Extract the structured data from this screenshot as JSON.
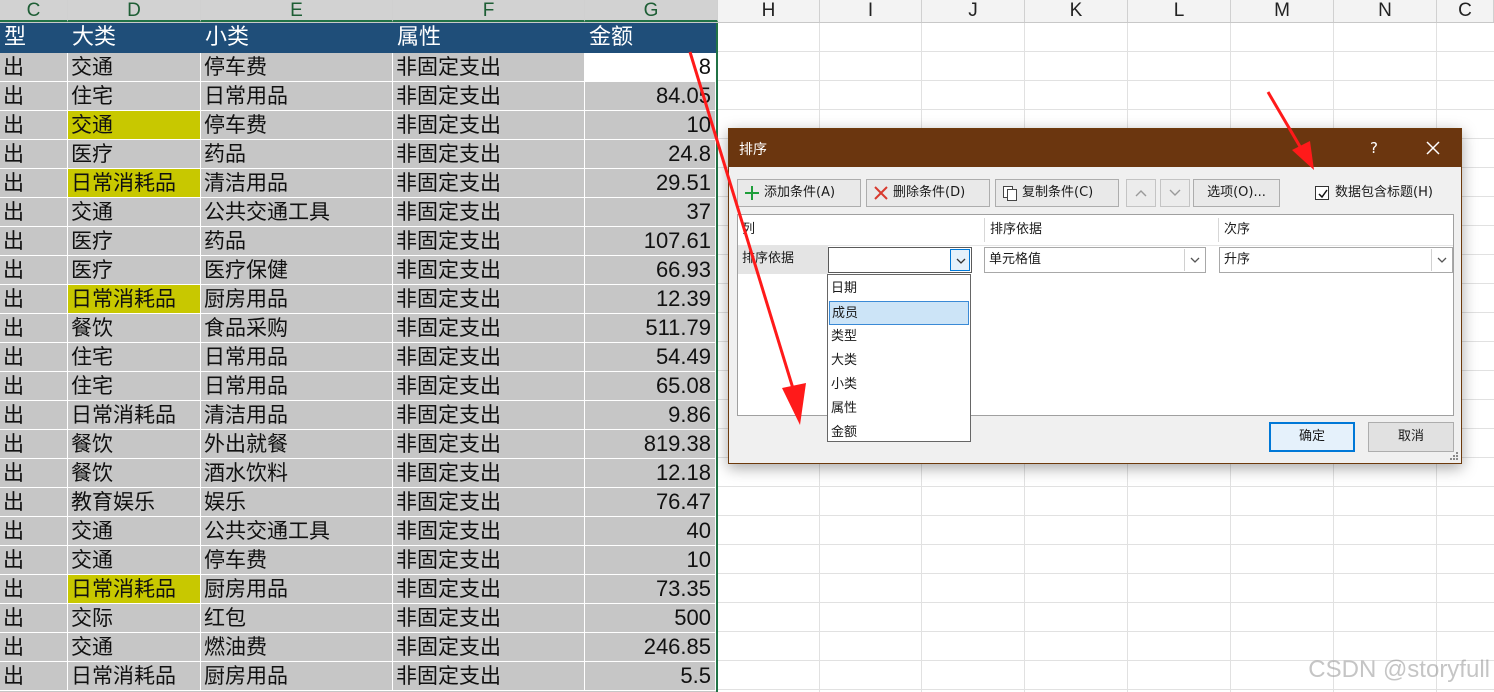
{
  "sheet": {
    "column_headers": [
      "C",
      "D",
      "E",
      "F",
      "G",
      "H",
      "I",
      "J",
      "K",
      "L",
      "M",
      "N",
      "C"
    ],
    "header_row": [
      "型",
      "大类",
      "小类",
      "属性",
      "金额"
    ],
    "rows": [
      [
        "出",
        "交通",
        "停车费",
        "非固定支出",
        "8"
      ],
      [
        "出",
        "住宅",
        "日常用品",
        "非固定支出",
        "84.05"
      ],
      [
        "出",
        "交通",
        "停车费",
        "非固定支出",
        "10"
      ],
      [
        "出",
        "医疗",
        "药品",
        "非固定支出",
        "24.8"
      ],
      [
        "出",
        "日常消耗品",
        "清洁用品",
        "非固定支出",
        "29.51"
      ],
      [
        "出",
        "交通",
        "公共交通工具",
        "非固定支出",
        "37"
      ],
      [
        "出",
        "医疗",
        "药品",
        "非固定支出",
        "107.61"
      ],
      [
        "出",
        "医疗",
        "医疗保健",
        "非固定支出",
        "66.93"
      ],
      [
        "出",
        "日常消耗品",
        "厨房用品",
        "非固定支出",
        "12.39"
      ],
      [
        "出",
        "餐饮",
        "食品采购",
        "非固定支出",
        "511.79"
      ],
      [
        "出",
        "住宅",
        "日常用品",
        "非固定支出",
        "54.49"
      ],
      [
        "出",
        "住宅",
        "日常用品",
        "非固定支出",
        "65.08"
      ],
      [
        "出",
        "日常消耗品",
        "清洁用品",
        "非固定支出",
        "9.86"
      ],
      [
        "出",
        "餐饮",
        "外出就餐",
        "非固定支出",
        "819.38"
      ],
      [
        "出",
        "餐饮",
        "酒水饮料",
        "非固定支出",
        "12.18"
      ],
      [
        "出",
        "教育娱乐",
        "娱乐",
        "非固定支出",
        "76.47"
      ],
      [
        "出",
        "交通",
        "公共交通工具",
        "非固定支出",
        "40"
      ],
      [
        "出",
        "交通",
        "停车费",
        "非固定支出",
        "10"
      ],
      [
        "出",
        "日常消耗品",
        "厨房用品",
        "非固定支出",
        "73.35"
      ],
      [
        "出",
        "交际",
        "红包",
        "非固定支出",
        "500"
      ],
      [
        "出",
        "交通",
        "燃油费",
        "非固定支出",
        "246.85"
      ],
      [
        "出",
        "日常消耗品",
        "厨房用品",
        "非固定支出",
        "5.5"
      ]
    ],
    "highlighted_rows": [
      2,
      4,
      8,
      18
    ],
    "colors": {
      "header_bg": "#1f4e79",
      "selection_bg": "#c6c6c6",
      "highlight": "#c8c800"
    }
  },
  "dialog": {
    "title": "排序",
    "help": "?",
    "toolbar": {
      "add": "添加条件(A)",
      "delete": "删除条件(D)",
      "copy": "复制条件(C)",
      "options": "选项(O)...",
      "header_checkbox_label": "数据包含标题(H)",
      "header_checkbox_checked": true
    },
    "columns": {
      "col": "列",
      "basis": "排序依据",
      "order": "次序"
    },
    "row": {
      "label": "排序依据",
      "column_value": "",
      "basis_value": "单元格值",
      "order_value": "升序"
    },
    "dropdown_options": [
      "日期",
      "成员",
      "类型",
      "大类",
      "小类",
      "属性",
      "金额"
    ],
    "dropdown_selected": "成员",
    "ok": "确定",
    "cancel": "取消"
  },
  "watermark": "CSDN @storyfull"
}
